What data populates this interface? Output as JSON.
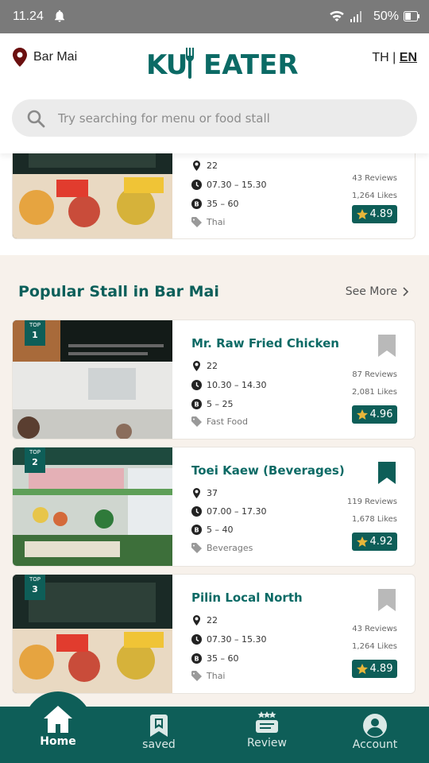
{
  "status_bar": {
    "time": "11.24",
    "battery": "50%"
  },
  "header": {
    "location": "Bar Mai",
    "logo_part1": "KU",
    "logo_part2": "EATER",
    "lang_th": "TH",
    "lang_sep": " | ",
    "lang_en": "EN"
  },
  "search": {
    "placeholder": "Try searching for menu or food stall"
  },
  "top_card": {
    "location": "22",
    "hours": "07.30 – 15.30",
    "price": "35 – 60",
    "category": "Thai",
    "reviews": "43  Reviews",
    "likes": "1,264 Likes",
    "rating": "4.89"
  },
  "popular": {
    "title": "Popular Stall in Bar Mai",
    "see_more": "See More",
    "stalls": [
      {
        "rank_label": "TOP",
        "rank": "1",
        "name": "Mr. Raw Fried Chicken",
        "location": "22",
        "hours": "10.30 – 14.30",
        "price": "5 – 25",
        "category": "Fast Food",
        "reviews": "87 Reviews",
        "likes": "2,081 Likes",
        "rating": "4.96",
        "saved": false
      },
      {
        "rank_label": "TOP",
        "rank": "2",
        "name": "Toei Kaew (Beverages)",
        "location": "37",
        "hours": "07.00 – 17.30",
        "price": "5 – 40",
        "category": "Beverages",
        "reviews": "119 Reviews",
        "likes": "1,678 Likes",
        "rating": "4.92",
        "saved": true
      },
      {
        "rank_label": "TOP",
        "rank": "3",
        "name": "Pilin Local North",
        "location": "22",
        "hours": "07.30 – 15.30",
        "price": "35 – 60",
        "category": "Thai",
        "reviews": "43  Reviews",
        "likes": "1,264 Likes",
        "rating": "4.89",
        "saved": false
      }
    ]
  },
  "bottom_nav": {
    "home": "Home",
    "saved": "saved",
    "review": "Review",
    "account": "Account"
  },
  "colors": {
    "brand": "#0b6a65",
    "nav_bg": "#0e5e58",
    "bookmark_inactive": "#b9b9b9",
    "star": "#e8b63a"
  }
}
